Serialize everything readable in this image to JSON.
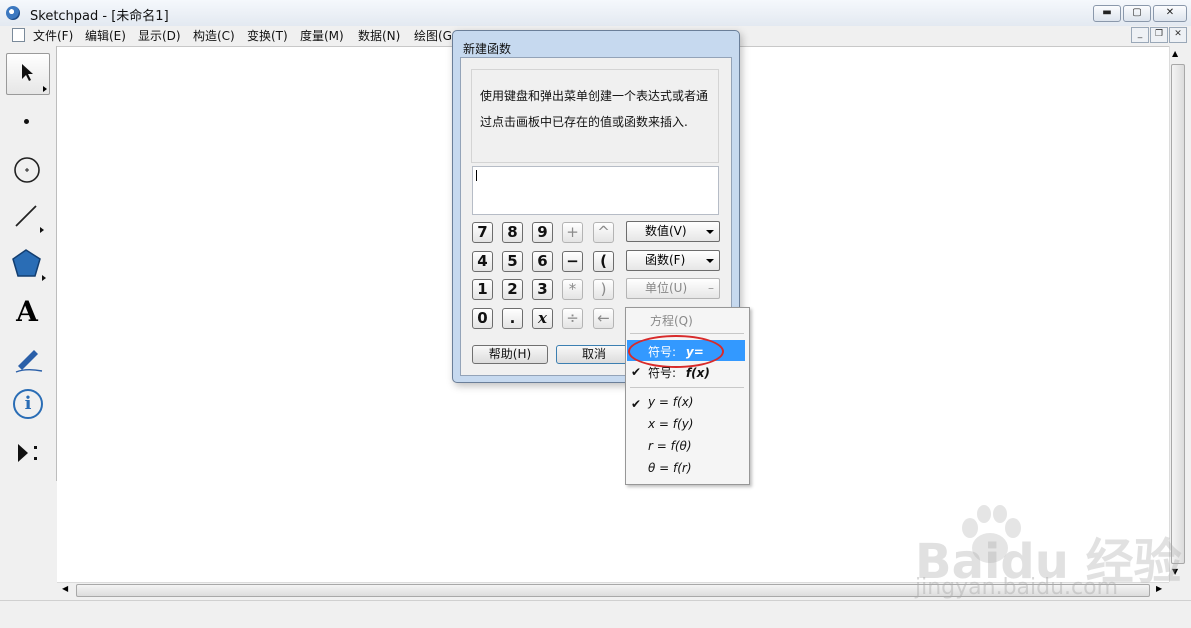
{
  "window": {
    "title": "Sketchpad  - [未命名1]",
    "min": "▬",
    "max": "▢",
    "close": "✕"
  },
  "menus": [
    "文件(F)",
    "编辑(E)",
    "显示(D)",
    "构造(C)",
    "变换(T)",
    "度量(M)",
    "数据(N)",
    "绘图(G"
  ],
  "mdi": {
    "min": "_",
    "restore": "❐",
    "close": "✕"
  },
  "tools": [
    {
      "name": "select-arrow-icon"
    },
    {
      "name": "point-icon"
    },
    {
      "name": "compass-icon"
    },
    {
      "name": "straightedge-icon"
    },
    {
      "name": "polygon-icon"
    },
    {
      "name": "text-icon",
      "label": "A"
    },
    {
      "name": "marker-icon"
    },
    {
      "name": "information-icon",
      "label": "i"
    },
    {
      "name": "custom-tools-icon"
    }
  ],
  "dialog": {
    "title": "新建函数",
    "description_line1": "使用键盘和弹出菜单创建一个表达式或者通",
    "description_line2": "过点击画板中已存在的值或函数来插入.",
    "keypad": {
      "row1": [
        "7",
        "8",
        "9",
        "+",
        "^"
      ],
      "row2": [
        "4",
        "5",
        "6",
        "−",
        "("
      ],
      "row3": [
        "1",
        "2",
        "3",
        "*",
        ")"
      ],
      "row4": [
        "0",
        ".",
        "x",
        "÷",
        "←"
      ]
    },
    "value_dropdown": "数值(V)",
    "function_dropdown": "函数(F)",
    "unit_dropdown": "单位(U)",
    "help_button": "帮助(H)",
    "cancel_button": "取消"
  },
  "popup_menu": {
    "equation": "方程(Q)",
    "symbol_y_label": "符号:",
    "symbol_y_value": "y=",
    "symbol_fx_label": "符号:",
    "symbol_fx_value": "f(x)",
    "items": [
      "y = f(x)",
      "x = f(y)",
      "r = f(θ)",
      "θ = f(r)"
    ],
    "check": "✔"
  },
  "watermark": {
    "brand": "Baidu 经验",
    "url": "jingyan.baidu.com"
  }
}
